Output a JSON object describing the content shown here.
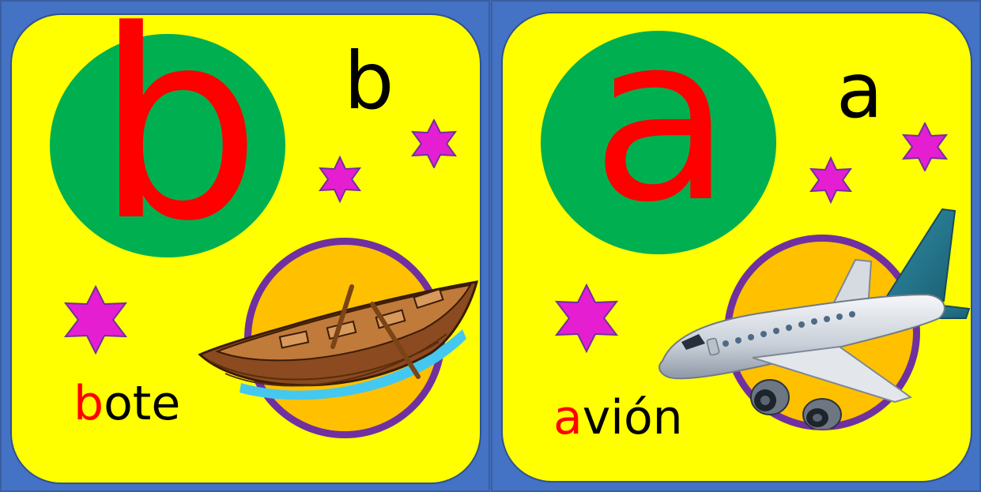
{
  "cards": [
    {
      "big_letter": "b",
      "small_letter": "b",
      "word_first": "b",
      "word_rest": "ote",
      "picture_icon": "rowboat-icon"
    },
    {
      "big_letter": "a",
      "small_letter": "a",
      "word_first": "a",
      "word_rest": "vión",
      "picture_icon": "airplane-icon"
    }
  ],
  "colors": {
    "background": "#4472c4",
    "card": "#ffff00",
    "circle": "#00b050",
    "letter_red": "#ff0000",
    "star": "#e61ed2",
    "orbit_fill": "#ffc000",
    "orbit_ring": "#7030a0"
  }
}
